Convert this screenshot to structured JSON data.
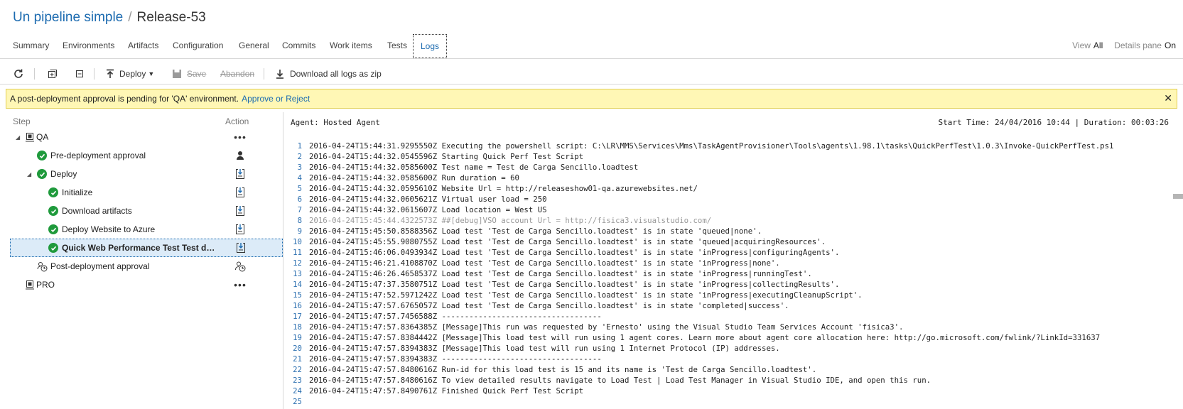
{
  "header": {
    "pipeline": "Un pipeline simple",
    "separator": "/",
    "release": "Release-53"
  },
  "tabs": [
    "Summary",
    "Environments",
    "Artifacts",
    "Configuration",
    "General",
    "Commits",
    "Work items",
    "Tests",
    "Logs"
  ],
  "active_tab": "Logs",
  "view_options": {
    "view_label": "View",
    "view_value": "All",
    "details_label": "Details pane",
    "details_value": "On"
  },
  "toolbar": {
    "deploy": "Deploy",
    "save": "Save",
    "abandon": "Abandon",
    "download": "Download all logs as zip"
  },
  "banner": {
    "message": "A post-deployment approval is pending for 'QA' environment.",
    "link": "Approve or Reject",
    "close": "✕"
  },
  "steps_header": {
    "step": "Step",
    "action": "Action"
  },
  "steps": [
    {
      "label": "QA",
      "action": "•••"
    },
    {
      "label": "Pre-deployment approval"
    },
    {
      "label": "Deploy"
    },
    {
      "label": "Initialize"
    },
    {
      "label": "Download artifacts"
    },
    {
      "label": "Deploy Website to Azure"
    },
    {
      "label": "Quick Web Performance Test Test de..."
    },
    {
      "label": "Post-deployment approval"
    },
    {
      "label": "PRO",
      "action": "•••"
    }
  ],
  "log": {
    "agent": "Agent: Hosted Agent",
    "start": "Start Time: 24/04/2016 10:44 | Duration: 00:03:26",
    "lines": [
      "2016-04-24T15:44:31.9295550Z Executing the powershell script: C:\\LR\\MMS\\Services\\Mms\\TaskAgentProvisioner\\Tools\\agents\\1.98.1\\tasks\\QuickPerfTest\\1.0.3\\Invoke-QuickPerfTest.ps1",
      "2016-04-24T15:44:32.0545596Z Starting Quick Perf Test Script",
      "2016-04-24T15:44:32.0585600Z Test name = Test de Carga Sencillo.loadtest",
      "2016-04-24T15:44:32.0585600Z Run duration = 60",
      "2016-04-24T15:44:32.0595610Z Website Url = http://releaseshow01-qa.azurewebsites.net/",
      "2016-04-24T15:44:32.0605621Z Virtual user load = 250",
      "2016-04-24T15:44:32.0615607Z Load location = West US",
      "2016-04-24T15:45:44.4322573Z ##[debug]VSO account Url = http://fisica3.visualstudio.com/",
      "2016-04-24T15:45:50.8588356Z Load test 'Test de Carga Sencillo.loadtest' is in state 'queued|none'.",
      "2016-04-24T15:45:55.9080755Z Load test 'Test de Carga Sencillo.loadtest' is in state 'queued|acquiringResources'.",
      "2016-04-24T15:46:06.0493934Z Load test 'Test de Carga Sencillo.loadtest' is in state 'inProgress|configuringAgents'.",
      "2016-04-24T15:46:21.4108870Z Load test 'Test de Carga Sencillo.loadtest' is in state 'inProgress|none'.",
      "2016-04-24T15:46:26.4658537Z Load test 'Test de Carga Sencillo.loadtest' is in state 'inProgress|runningTest'.",
      "2016-04-24T15:47:37.3580751Z Load test 'Test de Carga Sencillo.loadtest' is in state 'inProgress|collectingResults'.",
      "2016-04-24T15:47:52.5971242Z Load test 'Test de Carga Sencillo.loadtest' is in state 'inProgress|executingCleanupScript'.",
      "2016-04-24T15:47:57.6765057Z Load test 'Test de Carga Sencillo.loadtest' is in state 'completed|success'.",
      "2016-04-24T15:47:57.7456588Z -----------------------------------",
      "2016-04-24T15:47:57.8364385Z [Message]This run was requested by 'Ernesto' using the Visual Studio Team Services Account 'fisica3'.",
      "2016-04-24T15:47:57.8384442Z [Message]This load test will run using 1 agent cores. Learn more about agent core allocation here: http://go.microsoft.com/fwlink/?LinkId=331637",
      "2016-04-24T15:47:57.8394383Z [Message]This load test will run using 1 Internet Protocol (IP) addresses.",
      "2016-04-24T15:47:57.8394383Z -----------------------------------",
      "2016-04-24T15:47:57.8480616Z Run-id for this load test is 15 and its name is 'Test de Carga Sencillo.loadtest'.",
      "2016-04-24T15:47:57.8480616Z To view detailed results navigate to Load Test | Load Test Manager in Visual Studio IDE, and open this run.",
      "2016-04-24T15:47:57.8490761Z Finished Quick Perf Test Script",
      ""
    ]
  },
  "colors": {
    "link": "#1c6bb0",
    "success": "#1f9a3c",
    "banner_bg": "#fff7b5",
    "selected_bg": "#dcebf8"
  }
}
